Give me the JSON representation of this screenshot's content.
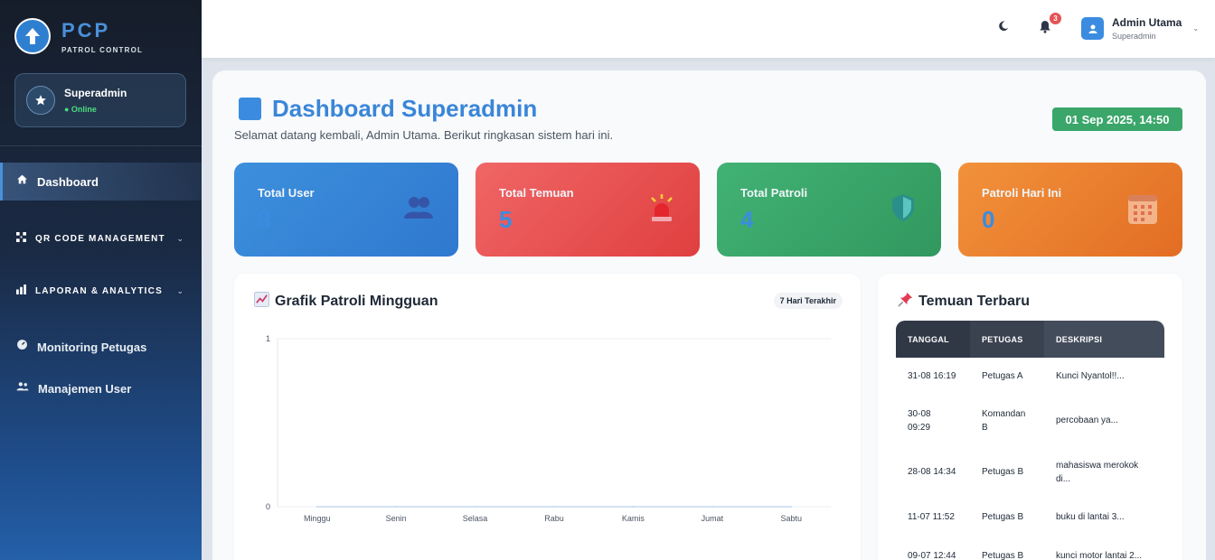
{
  "brand": {
    "name": "PCP",
    "subtitle": "PATROL CONTROL"
  },
  "sidebar": {
    "user": {
      "name": "Superadmin",
      "status": "● Online"
    },
    "items": [
      {
        "label": "Dashboard",
        "icon": "home-icon"
      },
      {
        "label": "QR CODE MANAGEMENT",
        "icon": "qr-icon"
      },
      {
        "label": "LAPORAN & ANALYTICS",
        "icon": "bar-chart-icon"
      },
      {
        "label": "Monitoring Petugas",
        "icon": "gauge-icon"
      },
      {
        "label": "Manajemen User",
        "icon": "users-icon"
      }
    ]
  },
  "topbar": {
    "notification_count": "3",
    "profile": {
      "name": "Admin Utama",
      "role": "Superadmin"
    }
  },
  "header": {
    "title": "Dashboard Superadmin",
    "subtitle": "Selamat datang kembali, Admin Utama. Berikut ringkasan sistem hari ini.",
    "datetime": "01 Sep 2025, 14:50"
  },
  "stats": [
    {
      "label": "Total User",
      "value": "8",
      "color": "#3d90dd"
    },
    {
      "label": "Total Temuan",
      "value": "5",
      "color": "#f06666"
    },
    {
      "label": "Total Patroli",
      "value": "4",
      "color": "#42b274"
    },
    {
      "label": "Patroli Hari Ini",
      "value": "0",
      "color": "#f2923b"
    }
  ],
  "chart_panel": {
    "title": "Grafik Patroli Mingguan",
    "range_chip": "7 Hari Terakhir"
  },
  "chart_data": {
    "type": "line",
    "categories": [
      "Minggu",
      "Senin",
      "Selasa",
      "Rabu",
      "Kamis",
      "Jumat",
      "Sabtu"
    ],
    "series": [
      {
        "values": [
          0,
          0,
          0,
          0,
          0,
          0,
          0
        ]
      }
    ],
    "ylim": [
      0,
      1
    ],
    "yticks": [
      "0",
      "1"
    ],
    "grid": true
  },
  "recent": {
    "title": "Temuan Terbaru",
    "columns": [
      "TANGGAL",
      "PETUGAS",
      "DESKRIPSI"
    ],
    "rows": [
      [
        "31-08 16:19",
        "Petugas A",
        "Kunci Nyantol!!..."
      ],
      [
        "30-08 09:29",
        "Komandan B",
        "percobaan ya..."
      ],
      [
        "28-08 14:34",
        "Petugas B",
        "mahasiswa merokok di..."
      ],
      [
        "11-07 11:52",
        "Petugas B",
        "buku di lantai 3..."
      ],
      [
        "09-07 12:44",
        "Petugas B",
        "kunci motor lantai 2..."
      ]
    ]
  }
}
